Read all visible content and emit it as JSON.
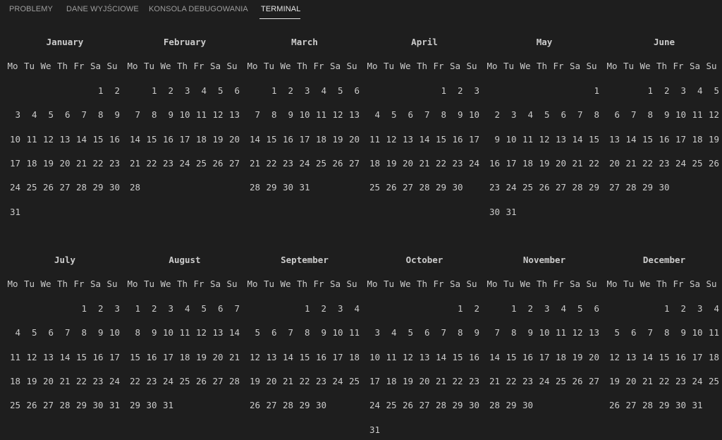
{
  "tabs": [
    {
      "label": "PROBLEMY",
      "active": false
    },
    {
      "label": "DANE WYJŚCIOWE",
      "active": false
    },
    {
      "label": "KONSOLA DEBUGOWANIA",
      "active": false
    },
    {
      "label": "TERMINAL",
      "active": true
    }
  ],
  "weekdays": [
    "Mo",
    "Tu",
    "We",
    "Th",
    "Fr",
    "Sa",
    "Su"
  ],
  "months": [
    {
      "name": "January",
      "offset": 5,
      "days": 31
    },
    {
      "name": "February",
      "offset": 1,
      "days": 28
    },
    {
      "name": "March",
      "offset": 1,
      "days": 31
    },
    {
      "name": "April",
      "offset": 4,
      "days": 30
    },
    {
      "name": "May",
      "offset": 6,
      "days": 31
    },
    {
      "name": "June",
      "offset": 2,
      "days": 30
    },
    {
      "name": "July",
      "offset": 4,
      "days": 31
    },
    {
      "name": "August",
      "offset": 0,
      "days": 31
    },
    {
      "name": "September",
      "offset": 3,
      "days": 30
    },
    {
      "name": "October",
      "offset": 5,
      "days": 31
    },
    {
      "name": "November",
      "offset": 1,
      "days": 30
    },
    {
      "name": "December",
      "offset": 3,
      "days": 31
    }
  ],
  "colors": {
    "background": "#1e1e1e",
    "text": "#cccccc",
    "tab_inactive": "#9d9d9d",
    "tab_active": "#e7e7e7"
  }
}
